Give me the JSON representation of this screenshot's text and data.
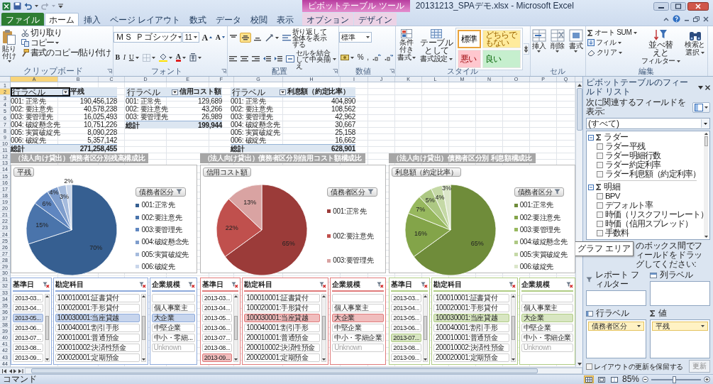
{
  "title_bar": {
    "title": "20131213_SPAデモ.xlsx - Microsoft Excel",
    "contextual_group": "ピボットテーブル ツール"
  },
  "ribbon_tabs": [
    {
      "label": "ファイル",
      "kind": "file",
      "selected": false
    },
    {
      "label": "ホーム",
      "kind": "normal",
      "selected": true
    },
    {
      "label": "挿入",
      "kind": "normal",
      "selected": false
    },
    {
      "label": "ページ レイアウト",
      "kind": "normal",
      "selected": false
    },
    {
      "label": "数式",
      "kind": "normal",
      "selected": false
    },
    {
      "label": "データ",
      "kind": "normal",
      "selected": false
    },
    {
      "label": "校閲",
      "kind": "normal",
      "selected": false
    },
    {
      "label": "表示",
      "kind": "normal",
      "selected": false
    },
    {
      "label": "オプション",
      "kind": "contextual",
      "selected": false
    },
    {
      "label": "デザイン",
      "kind": "contextual",
      "selected": false
    }
  ],
  "ribbon": {
    "clipboard": {
      "paste": "貼り付け",
      "cut": "切り取り",
      "copy": "コピー",
      "format_painter": "書式のコピー/貼り付け",
      "label": "クリップボード"
    },
    "font": {
      "font_name": "ＭＳ Ｐゴシック",
      "font_size": "11",
      "grow": "A",
      "shrink": "A",
      "bold": "B",
      "italic": "I",
      "underline": "U",
      "font_color": "A",
      "label": "フォント"
    },
    "alignment": {
      "vertical": [
        {
          "kind": "top",
          "selected": false
        },
        {
          "kind": "middle",
          "selected": true
        },
        {
          "kind": "bottom",
          "selected": false
        }
      ],
      "wrap_text": "折り返して全体を表示する",
      "merge": "セルを結合して中央揃え",
      "label": "配置"
    },
    "number": {
      "format": "標準",
      "percent": "%",
      "comma": ",",
      "label": "数値"
    },
    "styles": {
      "conditional": [
        "条件付き",
        "書式"
      ],
      "table": [
        "テーブルとして",
        "書式設定"
      ],
      "gallery": [
        {
          "label": "標準",
          "kind": "normal",
          "selected": true
        },
        {
          "label": "どちらでもない",
          "kind": "neutral",
          "selected": false
        },
        {
          "label": "悪い",
          "kind": "bad",
          "selected": false
        },
        {
          "label": "良い",
          "kind": "good",
          "selected": false
        }
      ],
      "label": "スタイル"
    },
    "cells": {
      "buttons": [
        {
          "label": "挿入",
          "kind": "insert"
        },
        {
          "label": "削除",
          "kind": "delete"
        },
        {
          "label": "書式",
          "kind": "format"
        }
      ],
      "label": "セル"
    },
    "editing": {
      "autosum": "オート SUM",
      "fill": "フィル",
      "clear": "クリア",
      "sort_filter": [
        "並べ替えと",
        "フィルター"
      ],
      "find_select": [
        "検索と",
        "選択"
      ],
      "label": "編集"
    }
  },
  "sheet": {
    "columns": [
      {
        "label": "A",
        "selected": true
      },
      {
        "label": "B",
        "selected": false
      },
      {
        "label": "C",
        "selected": false
      },
      {
        "label": "D",
        "selected": false
      },
      {
        "label": "E",
        "selected": false
      },
      {
        "label": "F",
        "selected": false
      },
      {
        "label": "G",
        "selected": false
      },
      {
        "label": "H",
        "selected": false
      },
      {
        "label": "I",
        "selected": false
      },
      {
        "label": "J",
        "selected": false
      },
      {
        "label": "K",
        "selected": false
      },
      {
        "label": "L",
        "selected": false
      },
      {
        "label": "M",
        "selected": false
      },
      {
        "label": "N",
        "selected": false
      },
      {
        "label": "O",
        "selected": false
      },
      {
        "label": "P",
        "selected": false
      },
      {
        "label": "Q",
        "selected": false
      }
    ],
    "rows": [
      {
        "label": "1",
        "selected": false
      },
      {
        "label": "2",
        "selected": true
      },
      {
        "label": "3",
        "selected": false
      },
      {
        "label": "4",
        "selected": false
      },
      {
        "label": "5",
        "selected": false
      },
      {
        "label": "6",
        "selected": false
      },
      {
        "label": "7",
        "selected": false
      },
      {
        "label": "8",
        "selected": false
      },
      {
        "label": "9",
        "selected": false
      },
      {
        "label": "10",
        "selected": false
      },
      {
        "label": "11",
        "selected": false
      },
      {
        "label": "12",
        "selected": false
      },
      {
        "label": "13",
        "selected": false
      },
      {
        "label": "14",
        "selected": false
      },
      {
        "label": "15",
        "selected": false
      },
      {
        "label": "16",
        "selected": false
      },
      {
        "label": "17",
        "selected": false
      },
      {
        "label": "18",
        "selected": false
      },
      {
        "label": "19",
        "selected": false
      },
      {
        "label": "20",
        "selected": false
      },
      {
        "label": "21",
        "selected": false
      },
      {
        "label": "22",
        "selected": false
      },
      {
        "label": "23",
        "selected": false
      },
      {
        "label": "24",
        "selected": false
      },
      {
        "label": "25",
        "selected": false
      },
      {
        "label": "26",
        "selected": false
      },
      {
        "label": "27",
        "selected": false
      },
      {
        "label": "28",
        "selected": false
      },
      {
        "label": "29",
        "selected": false
      },
      {
        "label": "30",
        "selected": false
      },
      {
        "label": "31",
        "selected": false
      },
      {
        "label": "32",
        "selected": false
      },
      {
        "label": "33",
        "selected": false
      },
      {
        "label": "34",
        "selected": false
      },
      {
        "label": "35",
        "selected": false
      },
      {
        "label": "36",
        "selected": false
      },
      {
        "label": "37",
        "selected": false
      },
      {
        "label": "38",
        "selected": false
      },
      {
        "label": "39",
        "selected": false
      },
      {
        "label": "40",
        "selected": false
      },
      {
        "label": "41",
        "selected": false
      },
      {
        "label": "42",
        "selected": false
      },
      {
        "label": "43",
        "selected": false
      },
      {
        "label": "44",
        "selected": false
      }
    ]
  },
  "pivot_tables": [
    {
      "header_label": "行ラベル",
      "value_header": "平残",
      "header_active": true,
      "rows": [
        {
          "label": "001: 正常先",
          "value": "190,456,128"
        },
        {
          "label": "002: 要注意先",
          "value": "40,578,238"
        },
        {
          "label": "003: 要管理先",
          "value": "16,025,493"
        },
        {
          "label": "004: 破綻懸念先",
          "value": "10,751,226"
        },
        {
          "label": "005: 実質破綻先",
          "value": "8,090,228"
        },
        {
          "label": "006: 破綻先",
          "value": "5,357,142"
        }
      ],
      "total": {
        "label": "総計",
        "value": "271,258,455"
      }
    },
    {
      "header_label": "行ラベル",
      "value_header": "信用コスト額",
      "header_active": false,
      "rows": [
        {
          "label": "001: 正常先",
          "value": "129,689"
        },
        {
          "label": "002: 要注意先",
          "value": "43,266"
        },
        {
          "label": "003: 要管理先",
          "value": "26,989"
        }
      ],
      "total": {
        "label": "総計",
        "value": "199,944"
      }
    },
    {
      "header_label": "行ラベル",
      "value_header": "利息額（約定比率）",
      "header_active": false,
      "rows": [
        {
          "label": "001: 正常先",
          "value": "404,890"
        },
        {
          "label": "002: 要注意先",
          "value": "108,562"
        },
        {
          "label": "003: 要管理先",
          "value": "42,962"
        },
        {
          "label": "004: 破綻懸念先",
          "value": "30,667"
        },
        {
          "label": "005: 実質破綻先",
          "value": "25,158"
        },
        {
          "label": "006: 破綻先",
          "value": "16,662"
        }
      ],
      "total": {
        "label": "総計",
        "value": "628,901"
      }
    }
  ],
  "charts": [
    {
      "title": "（法人向け貸出）債務者区分別残高構成比",
      "legend_title": "債務者区分",
      "slices": [
        {
          "color": "#365f91"
        },
        {
          "color": "#4a74ab"
        },
        {
          "color": "#5f86c0"
        },
        {
          "color": "#7e9dcc"
        },
        {
          "color": "#a5bbdd"
        },
        {
          "color": "#c9d6eb"
        }
      ],
      "chart_data": {
        "type": "pie",
        "legend": "right",
        "categories": [
          "001:正常先",
          "002:要注意先",
          "003:要管理先",
          "004:破綻懸念先",
          "005:実質破綻先",
          "006:破綻先"
        ],
        "series": [
          {
            "name": "平残",
            "values": [
              70,
              15,
              6,
              4,
              3,
              2
            ]
          }
        ],
        "value_labels": [
          "70%",
          "15%",
          "6%",
          "4%",
          "3%",
          "2%"
        ]
      }
    },
    {
      "title": "（法人向け貸出）債務者区分別信用コスト額構成比",
      "legend_title": "債務者区分",
      "slices": [
        {
          "color": "#9b3b39"
        },
        {
          "color": "#c0504d"
        },
        {
          "color": "#d9a3a2"
        }
      ],
      "chart_data": {
        "type": "pie",
        "legend": "right",
        "categories": [
          "001:正常先",
          "002:要注意先",
          "003:要管理先"
        ],
        "series": [
          {
            "name": "信用コスト額",
            "values": [
              65,
              22,
              13
            ]
          }
        ],
        "value_labels": [
          "65%",
          "22%",
          "13%"
        ]
      }
    },
    {
      "title": "（法人向け貸出）債務者区分別 利息額構成比",
      "legend_title": "債務者区分",
      "slices": [
        {
          "color": "#6f8c3a"
        },
        {
          "color": "#83a449"
        },
        {
          "color": "#97b85e"
        },
        {
          "color": "#adc883"
        },
        {
          "color": "#c5d9a6"
        },
        {
          "color": "#dbe6c9"
        }
      ],
      "chart_data": {
        "type": "pie",
        "legend": "right",
        "categories": [
          "001:正常先",
          "002:要注意先",
          "003:要管理先",
          "004:破綻懸念先",
          "005:実質破綻先",
          "006:破綻先"
        ],
        "series": [
          {
            "name": "利息額（約定比率）",
            "values": [
              65,
              16,
              7,
              5,
              4,
              3
            ]
          }
        ],
        "value_labels": [
          "65%",
          "16%",
          "7%",
          "5%",
          "4%",
          "3%"
        ]
      }
    }
  ],
  "slicer_groups": [
    {
      "color": "#8eaadb",
      "slicers": [
        {
          "title": "基準日",
          "kind": "date",
          "blank_item": false,
          "scrollbar": true,
          "items": [
            {
              "label": "2013-03...",
              "selected": false,
              "disabled": false
            },
            {
              "label": "2013-04...",
              "selected": false,
              "disabled": false
            },
            {
              "label": "2013-05...",
              "selected": true,
              "disabled": false
            },
            {
              "label": "2013-06...",
              "selected": false,
              "disabled": false
            },
            {
              "label": "2013-07...",
              "selected": false,
              "disabled": false
            },
            {
              "label": "2013-08...",
              "selected": false,
              "disabled": false
            },
            {
              "label": "2013-09...",
              "selected": false,
              "disabled": false
            }
          ]
        },
        {
          "title": "勘定科目",
          "kind": "account",
          "blank_item": false,
          "scrollbar": true,
          "items": [
            {
              "label": "100010001:証書貸付",
              "selected": false,
              "disabled": false
            },
            {
              "label": "100020001:手形貸付",
              "selected": false,
              "disabled": false
            },
            {
              "label": "100030001:当座貸越",
              "selected": true,
              "disabled": false
            },
            {
              "label": "100040001:割引手形",
              "selected": false,
              "disabled": false
            },
            {
              "label": "200010001:普通預金",
              "selected": false,
              "disabled": false
            },
            {
              "label": "200010002:決済性預金",
              "selected": false,
              "disabled": false
            },
            {
              "label": "200020001:定期預金",
              "selected": false,
              "disabled": false
            }
          ]
        },
        {
          "title": "企業規模",
          "kind": "size",
          "blank_item": true,
          "scrollbar": false,
          "items": [
            {
              "label": "個人事業主",
              "selected": false,
              "disabled": false
            },
            {
              "label": "大企業",
              "selected": true,
              "disabled": false
            },
            {
              "label": "中堅企業",
              "selected": false,
              "disabled": false
            },
            {
              "label": "中小・零細...",
              "selected": false,
              "disabled": false
            },
            {
              "label": "Unknown",
              "selected": false,
              "disabled": true
            }
          ]
        }
      ]
    },
    {
      "color": "#e07b7b",
      "slicers": [
        {
          "title": "基準日",
          "kind": "date",
          "blank_item": false,
          "scrollbar": true,
          "items": [
            {
              "label": "2013-03...",
              "selected": false,
              "disabled": false
            },
            {
              "label": "2013-04...",
              "selected": false,
              "disabled": false
            },
            {
              "label": "2013-05...",
              "selected": false,
              "disabled": false
            },
            {
              "label": "2013-06...",
              "selected": false,
              "disabled": false
            },
            {
              "label": "2013-07...",
              "selected": false,
              "disabled": false
            },
            {
              "label": "2013-08...",
              "selected": false,
              "disabled": false
            },
            {
              "label": "2013-09...",
              "selected": true,
              "disabled": false
            }
          ]
        },
        {
          "title": "勘定科目",
          "kind": "account",
          "blank_item": false,
          "scrollbar": true,
          "items": [
            {
              "label": "100010001:証書貸付",
              "selected": false,
              "disabled": false
            },
            {
              "label": "100020001:手形貸付",
              "selected": false,
              "disabled": false
            },
            {
              "label": "100030001:当座貸越",
              "selected": true,
              "disabled": false
            },
            {
              "label": "100040001:割引手形",
              "selected": false,
              "disabled": false
            },
            {
              "label": "200010001:普通預金",
              "selected": false,
              "disabled": false
            },
            {
              "label": "200010002:決済性預金",
              "selected": false,
              "disabled": false
            },
            {
              "label": "200020001:定期預金",
              "selected": false,
              "disabled": false
            }
          ]
        },
        {
          "title": "企業規模",
          "kind": "size",
          "blank_item": true,
          "scrollbar": false,
          "items": [
            {
              "label": "個人事業主",
              "selected": false,
              "disabled": false
            },
            {
              "label": "大企業",
              "selected": true,
              "disabled": false
            },
            {
              "label": "中堅企業",
              "selected": false,
              "disabled": false
            },
            {
              "label": "中小・零細企業",
              "selected": false,
              "disabled": false
            },
            {
              "label": "Unknown",
              "selected": false,
              "disabled": true
            }
          ]
        }
      ]
    },
    {
      "color": "#b0cc84",
      "slicers": [
        {
          "title": "基準日",
          "kind": "date",
          "blank_item": false,
          "scrollbar": true,
          "items": [
            {
              "label": "2013-03...",
              "selected": false,
              "disabled": false
            },
            {
              "label": "2013-04...",
              "selected": false,
              "disabled": false
            },
            {
              "label": "2013-05...",
              "selected": false,
              "disabled": false
            },
            {
              "label": "2013-06...",
              "selected": false,
              "disabled": false
            },
            {
              "label": "2013-07...",
              "selected": true,
              "disabled": false
            },
            {
              "label": "2013-08...",
              "selected": false,
              "disabled": false
            },
            {
              "label": "2013-09...",
              "selected": false,
              "disabled": false
            }
          ]
        },
        {
          "title": "勘定科目",
          "kind": "account",
          "blank_item": false,
          "scrollbar": true,
          "items": [
            {
              "label": "100010001:証書貸付",
              "selected": false,
              "disabled": false
            },
            {
              "label": "100020001:手形貸付",
              "selected": false,
              "disabled": false
            },
            {
              "label": "100030001:当座貸越",
              "selected": true,
              "disabled": false
            },
            {
              "label": "100040001:割引手形",
              "selected": false,
              "disabled": false
            },
            {
              "label": "200010001:普通預金",
              "selected": false,
              "disabled": false
            },
            {
              "label": "200010002:決済性預金",
              "selected": false,
              "disabled": false
            },
            {
              "label": "200020001:定期預金",
              "selected": false,
              "disabled": false
            }
          ]
        },
        {
          "title": "企業規模",
          "kind": "size",
          "blank_item": true,
          "scrollbar": false,
          "items": [
            {
              "label": "個人事業主",
              "selected": false,
              "disabled": false
            },
            {
              "label": "大企業",
              "selected": true,
              "disabled": false
            },
            {
              "label": "中堅企業",
              "selected": false,
              "disabled": false
            },
            {
              "label": "中小・零細企業",
              "selected": false,
              "disabled": false
            },
            {
              "label": "Unknown",
              "selected": false,
              "disabled": true
            }
          ]
        }
      ]
    }
  ],
  "field_list": {
    "title": "ピボットテーブルのフィールド リスト",
    "show_label": "次に関連するフィールドを表示:",
    "show_value": "(すべて)",
    "fields": [
      {
        "label": "ラダー",
        "expanded": true,
        "children": [
          {
            "label": "ラダー平残",
            "checked": false
          },
          {
            "label": "ラダー明細行数",
            "checked": false
          },
          {
            "label": "ラダー約定利率",
            "checked": false
          },
          {
            "label": "ラダー利息額（約定利率）",
            "checked": false
          }
        ]
      },
      {
        "label": "明細",
        "expanded": true,
        "children": [
          {
            "label": "BPV",
            "checked": false
          },
          {
            "label": "デフォルト率",
            "checked": false
          },
          {
            "label": "時価（リスクフリーレート）",
            "checked": false
          },
          {
            "label": "時価（信用スプレッド）",
            "checked": false
          },
          {
            "label": "手数料",
            "checked": false
          }
        ]
      }
    ],
    "drag_hint": "のボックス間でフィールドをドラッグしてください:",
    "areas": [
      {
        "kind": "filter",
        "label": "レポート フィルター"
      },
      {
        "kind": "columns",
        "label": "列ラベル"
      },
      {
        "kind": "rows",
        "label": "行ラベル",
        "fields": [
          "債務者区分"
        ]
      },
      {
        "kind": "values",
        "label": "値",
        "fields": [
          "平残"
        ]
      }
    ],
    "defer": {
      "label": "レイアウトの更新を保留する",
      "checked": false
    },
    "update_button": {
      "label": "更新",
      "disabled": true
    }
  },
  "tooltip": "グラフ エリア",
  "status_bar": {
    "mode": "コマンド",
    "views": [
      {
        "kind": "normal",
        "selected": true
      },
      {
        "kind": "page_layout",
        "selected": false
      },
      {
        "kind": "page_break",
        "selected": false
      }
    ],
    "zoom": "85%",
    "zoom_slider": {
      "level": 0.45
    }
  }
}
